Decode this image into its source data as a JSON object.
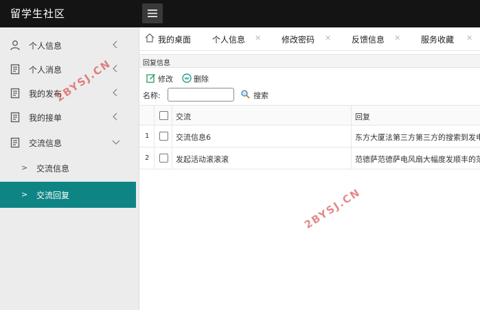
{
  "app": {
    "title": "留学生社区"
  },
  "sidebar": {
    "items": [
      {
        "label": "个人信息",
        "icon": "user-icon"
      },
      {
        "label": "个人消息",
        "icon": "document-icon"
      },
      {
        "label": "我的发布",
        "icon": "document-icon"
      },
      {
        "label": "我的接单",
        "icon": "document-icon"
      },
      {
        "label": "交流信息",
        "icon": "document-icon"
      }
    ],
    "subitems": [
      {
        "label": "交流信息",
        "active": false
      },
      {
        "label": "交流回复",
        "active": true
      }
    ]
  },
  "tabs": [
    {
      "label": "我的桌面",
      "icon": "home-icon"
    },
    {
      "label": "个人信息"
    },
    {
      "label": "修改密码"
    },
    {
      "label": "反馈信息"
    },
    {
      "label": "服务收藏"
    }
  ],
  "panel": {
    "title": "回复信息",
    "edit_label": "修改",
    "delete_label": "删除",
    "search_label": "名称:",
    "search_value": "",
    "search_button": "搜索"
  },
  "table": {
    "columns": [
      "交流",
      "回复"
    ],
    "rows": [
      {
        "num": "1",
        "col_a": "交流信息6",
        "col_b": "东方大厦法第三方第三方的搜索到发电"
      },
      {
        "num": "2",
        "col_a": "发起活动滚滚滚",
        "col_b": "范德萨范德萨电风扇大幅度发顺丰的范"
      }
    ]
  },
  "watermark": "2BYSJ.CN",
  "colors": {
    "topbar": "#141414",
    "sidebar": "#ececec",
    "active": "#0e8584",
    "watermark": "#d22828"
  }
}
